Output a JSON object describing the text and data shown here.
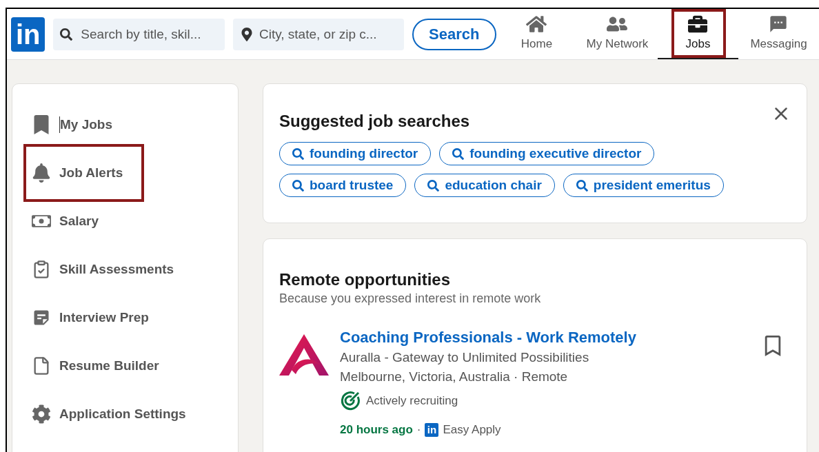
{
  "header": {
    "logo": "in",
    "search": {
      "placeholder": "Search by title, skil..."
    },
    "location": {
      "placeholder": "City, state, or zip c..."
    },
    "search_button": "Search",
    "nav": [
      {
        "label": "Home",
        "kind": "home",
        "selected": false,
        "annotated": false
      },
      {
        "label": "My Network",
        "kind": "network",
        "selected": false,
        "annotated": false
      },
      {
        "label": "Jobs",
        "kind": "jobs",
        "selected": true,
        "annotated": true
      },
      {
        "label": "Messaging",
        "kind": "messaging",
        "selected": false,
        "annotated": false
      }
    ]
  },
  "sidebar": {
    "items": [
      {
        "label": "My Jobs",
        "kind": "bookmark",
        "annotated": false,
        "text_cursor": true
      },
      {
        "label": "Job Alerts",
        "kind": "bell",
        "annotated": true,
        "text_cursor": false
      },
      {
        "label": "Salary",
        "kind": "money",
        "annotated": false,
        "text_cursor": false
      },
      {
        "label": "Skill Assessments",
        "kind": "clipboard",
        "annotated": false,
        "text_cursor": false
      },
      {
        "label": "Interview Prep",
        "kind": "note",
        "annotated": false,
        "text_cursor": false
      },
      {
        "label": "Resume Builder",
        "kind": "file",
        "annotated": false,
        "text_cursor": false
      },
      {
        "label": "Application Settings",
        "kind": "gear",
        "annotated": false,
        "text_cursor": false
      }
    ]
  },
  "suggested": {
    "title": "Suggested job searches",
    "chip_rows": [
      [
        "founding director",
        "founding executive director"
      ],
      [
        "board trustee",
        "education chair",
        "president emeritus"
      ]
    ]
  },
  "remote": {
    "title": "Remote opportunities",
    "subtitle": "Because you expressed interest in remote work",
    "job": {
      "title": "Coaching Professionals - Work Remotely",
      "company": "Auralla - Gateway to Unlimited Possibilities",
      "location": "Melbourne, Victoria, Australia · Remote",
      "status": "Actively recruiting",
      "posted": "20 hours ago",
      "separator": "·",
      "badge": "in",
      "apply": "Easy Apply",
      "saved": false
    }
  }
}
